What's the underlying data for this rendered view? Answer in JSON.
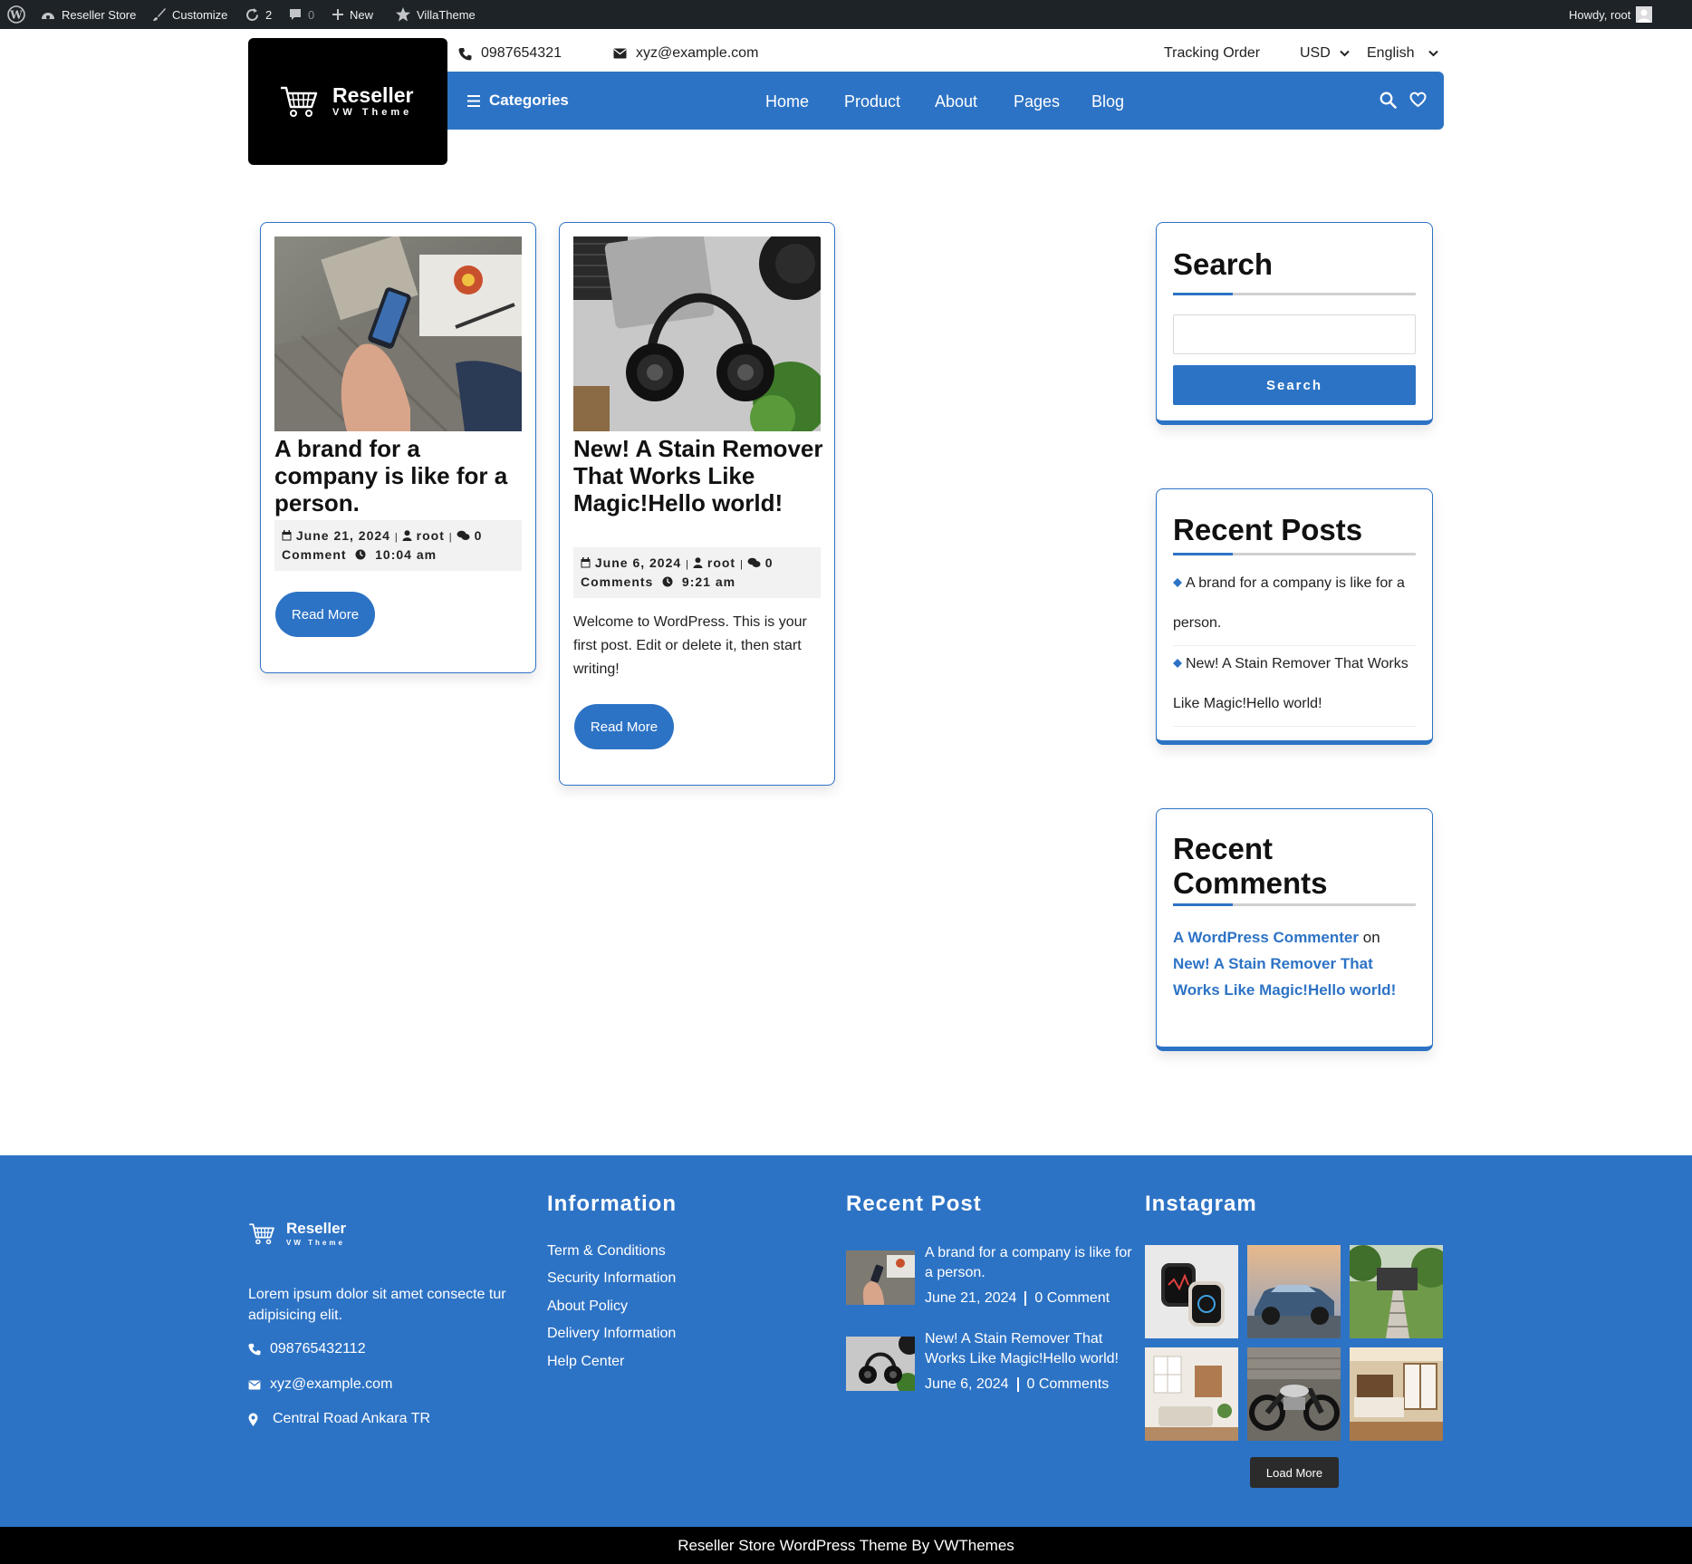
{
  "adminbar": {
    "site_name": "Reseller Store",
    "customize": "Customize",
    "updates_count": "2",
    "comments_count": "0",
    "new_label": "New",
    "theme_label": "VillaTheme",
    "howdy": "Howdy, root"
  },
  "header": {
    "logo_title": "Reseller",
    "logo_subtitle": "VW Theme",
    "phone": "0987654321",
    "email": "xyz@example.com",
    "tracking": "Tracking Order",
    "currency": "USD",
    "language": "English",
    "categories_label": "Categories",
    "nav": [
      "Home",
      "Product",
      "About",
      "Pages",
      "Blog"
    ]
  },
  "posts": [
    {
      "title": "A brand for a company is like for a person.",
      "date": "June 21, 2024",
      "author": "root",
      "comments": "0 Comment",
      "time": "10:04 am",
      "excerpt": "",
      "read_more": "Read More"
    },
    {
      "title": "New! A Stain Remover That Works Like Magic!Hello world!",
      "date": "June 6, 2024",
      "author": "root",
      "comments": "0 Comments",
      "time": "9:21 am",
      "excerpt": "Welcome to WordPress. This is your first post. Edit or delete it, then start writing!",
      "read_more": "Read More"
    }
  ],
  "sidebar": {
    "search_title": "Search",
    "search_value": "",
    "search_button": "Search",
    "recent_posts_title": "Recent Posts",
    "recent_posts": [
      "A brand for a company is like for a person.",
      "New! A Stain Remover That Works Like Magic!Hello world!"
    ],
    "recent_comments_title": "Recent Comments",
    "comment_author": "A WordPress Commenter",
    "comment_on": "on",
    "comment_post": "New! A Stain Remover That Works Like Magic!Hello world!"
  },
  "footer": {
    "logo_title": "Reseller",
    "logo_subtitle": "VW Theme",
    "about_text": "Lorem ipsum dolor sit amet consecte tur adipisicing elit.",
    "phone": "098765432112",
    "email": "xyz@example.com",
    "address": "Central Road Ankara TR",
    "information_title": "Information",
    "information_links": [
      "Term & Conditions",
      "Security Information",
      "About Policy",
      "Delivery Information",
      "Help Center"
    ],
    "recent_post_title": "Recent Post",
    "recent_posts": [
      {
        "title": "A brand for a company is like for a person.",
        "date": "June 21, 2024",
        "comments": "0 Comment"
      },
      {
        "title": "New! A Stain Remover That Works Like Magic!Hello world!",
        "date": "June 6, 2024",
        "comments": "0 Comments"
      }
    ],
    "instagram_title": "Instagram",
    "load_more": "Load More",
    "copyright": "Reseller Store WordPress Theme By VWThemes"
  },
  "colors": {
    "accent": "#2d73c5",
    "admin_bar": "#1d2327",
    "footer_bottom": "#000000"
  }
}
